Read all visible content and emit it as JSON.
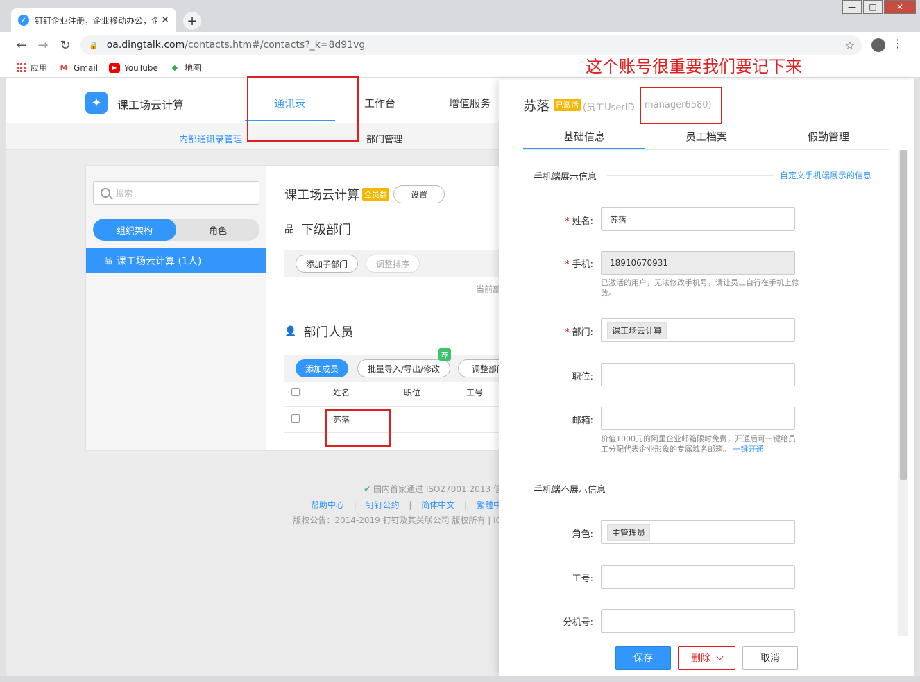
{
  "browser": {
    "tab_title": "钉钉企业注册，企业移动办公，企业",
    "url_host": "oa.dingtalk.com",
    "url_path": "/contacts.htm#/contacts?_k=8d91vg",
    "bookmarks": [
      "应用",
      "Gmail",
      "YouTube",
      "地图"
    ]
  },
  "annotation_text": "这个账号很重要我们要记下来",
  "topnav": {
    "company": "课工场云计算",
    "items": [
      "通讯录",
      "工作台",
      "增值服务"
    ]
  },
  "subnav": {
    "items": [
      "内部通讯录管理",
      "部门管理"
    ]
  },
  "left_panel": {
    "search_placeholder": "搜索",
    "segments": [
      "组织架构",
      "角色"
    ],
    "tree_item": "课工场云计算 (1人)"
  },
  "dept_panel": {
    "title": "课工场云计算",
    "badge": "全员群",
    "settings_button": "设置",
    "sub_dept_title": "下级部门",
    "add_sub_dept": "添加子部门",
    "adjust_order": "调整排序",
    "current_partial": "当前部",
    "members_title": "部门人员",
    "add_member": "添加成员",
    "batch": "批量导入/导出/修改",
    "recommend_tag": "荐",
    "adjust_dept": "调整部门",
    "table_headers": [
      "姓名",
      "职位",
      "工号"
    ],
    "rows": [
      {
        "name": "苏落"
      }
    ]
  },
  "footer": {
    "iso": "国内首家通过 ISO27001:2013 信",
    "links": [
      "帮助中心",
      "钉钉公约",
      "简体中文",
      "繁體中"
    ],
    "copyright": "版权公告：2014-2019 钉钉及其关联公司 版权所有 | IC"
  },
  "drawer": {
    "name": "苏落",
    "status_badge": "已激活",
    "userid_label": "(员工UserID",
    "userid_value": "manager6580)",
    "tabs": [
      "基础信息",
      "员工档案",
      "假勤管理"
    ],
    "section_shown": "手机端展示信息",
    "custom_link": "自定义手机端展示的信息",
    "fields": {
      "name": {
        "label": "姓名:",
        "value": "苏落"
      },
      "phone": {
        "label": "手机:",
        "value": "18910670931",
        "hint": "已激活的用户，无法修改手机号，请让员工自行在手机上修改。"
      },
      "dept": {
        "label": "部门:",
        "value": "课工场云计算"
      },
      "position": {
        "label": "职位:",
        "value": ""
      },
      "email": {
        "label": "邮箱:",
        "value": "",
        "hint": "价值1000元的阿里企业邮箱限时免费，开通后可一键给员工分配代表企业形象的专属域名邮箱。",
        "hint_link": "一键开通"
      },
      "role": {
        "label": "角色:",
        "value": "主管理员"
      },
      "job_no": {
        "label": "工号:",
        "value": ""
      },
      "ext": {
        "label": "分机号:",
        "value": ""
      }
    },
    "section_hidden": "手机端不展示信息",
    "buttons": {
      "save": "保存",
      "delete": "删除",
      "cancel": "取消"
    }
  }
}
